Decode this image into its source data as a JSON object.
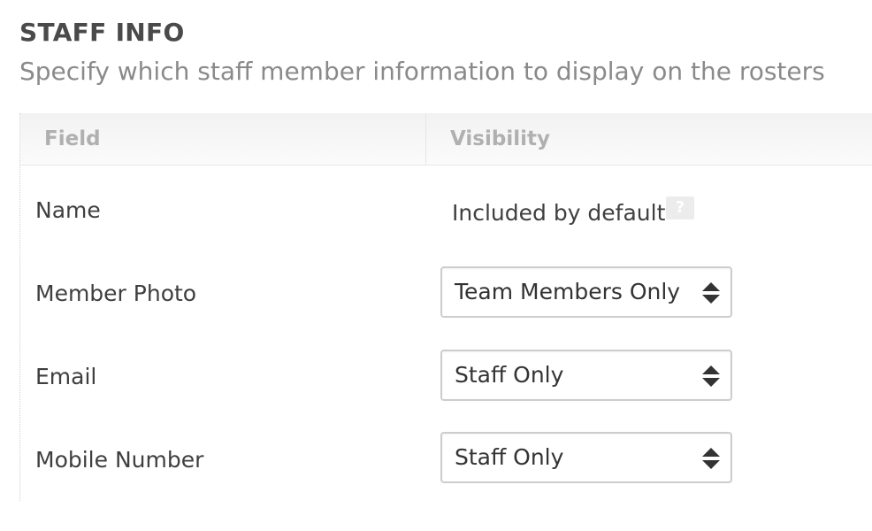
{
  "section": {
    "title": "STAFF INFO",
    "subtitle": "Specify which staff member information to display on the rosters"
  },
  "table": {
    "headers": {
      "field": "Field",
      "visibility": "Visibility"
    },
    "rows": [
      {
        "field": "Name",
        "visibility_text": "Included by default",
        "help_icon": "question-mark-icon"
      },
      {
        "field": "Member Photo",
        "visibility_value": "Team Members Only"
      },
      {
        "field": "Email",
        "visibility_value": "Staff Only"
      },
      {
        "field": "Mobile Number",
        "visibility_value": "Staff Only"
      }
    ]
  },
  "icons": {
    "help": "?",
    "select_arrows": "up-down-arrows-icon"
  }
}
